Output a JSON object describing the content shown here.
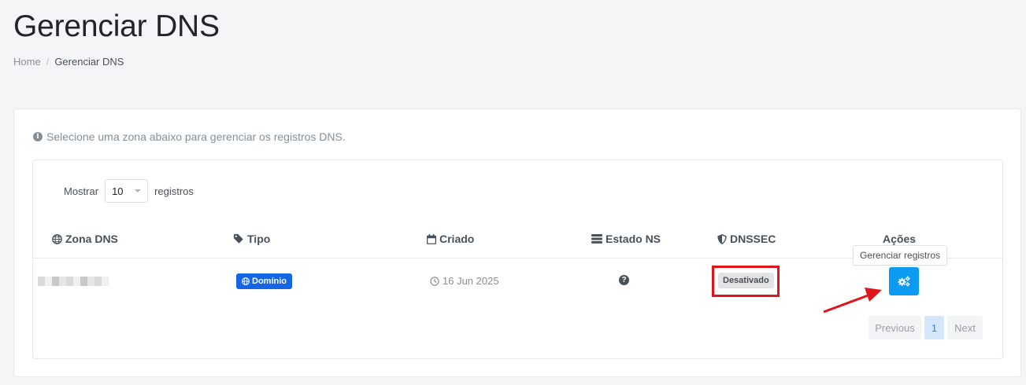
{
  "page": {
    "title": "Gerenciar DNS",
    "breadcrumb": {
      "home": "Home",
      "current": "Gerenciar DNS"
    }
  },
  "info": {
    "text": "Selecione uma zona abaixo para gerenciar os registros DNS.",
    "icon": "info-circle-icon"
  },
  "length_control": {
    "prefix": "Mostrar",
    "value": "10",
    "suffix": "registros"
  },
  "table": {
    "headers": {
      "zona": "Zona DNS",
      "tipo": "Tipo",
      "criado": "Criado",
      "estado_ns": "Estado NS",
      "dnssec": "DNSSEC",
      "acoes": "Ações"
    },
    "rows": [
      {
        "zona": "",
        "tipo": "Domínio",
        "criado": "16 Jun 2025",
        "estado_ns": "?",
        "dnssec": "Desativado"
      }
    ]
  },
  "tooltip": "Gerenciar registros",
  "pagination": {
    "previous": "Previous",
    "current": "1",
    "next": "Next"
  },
  "colors": {
    "accent_blue": "#0d9bf2",
    "badge_blue": "#1565e5",
    "highlight_red": "#e3131b"
  }
}
